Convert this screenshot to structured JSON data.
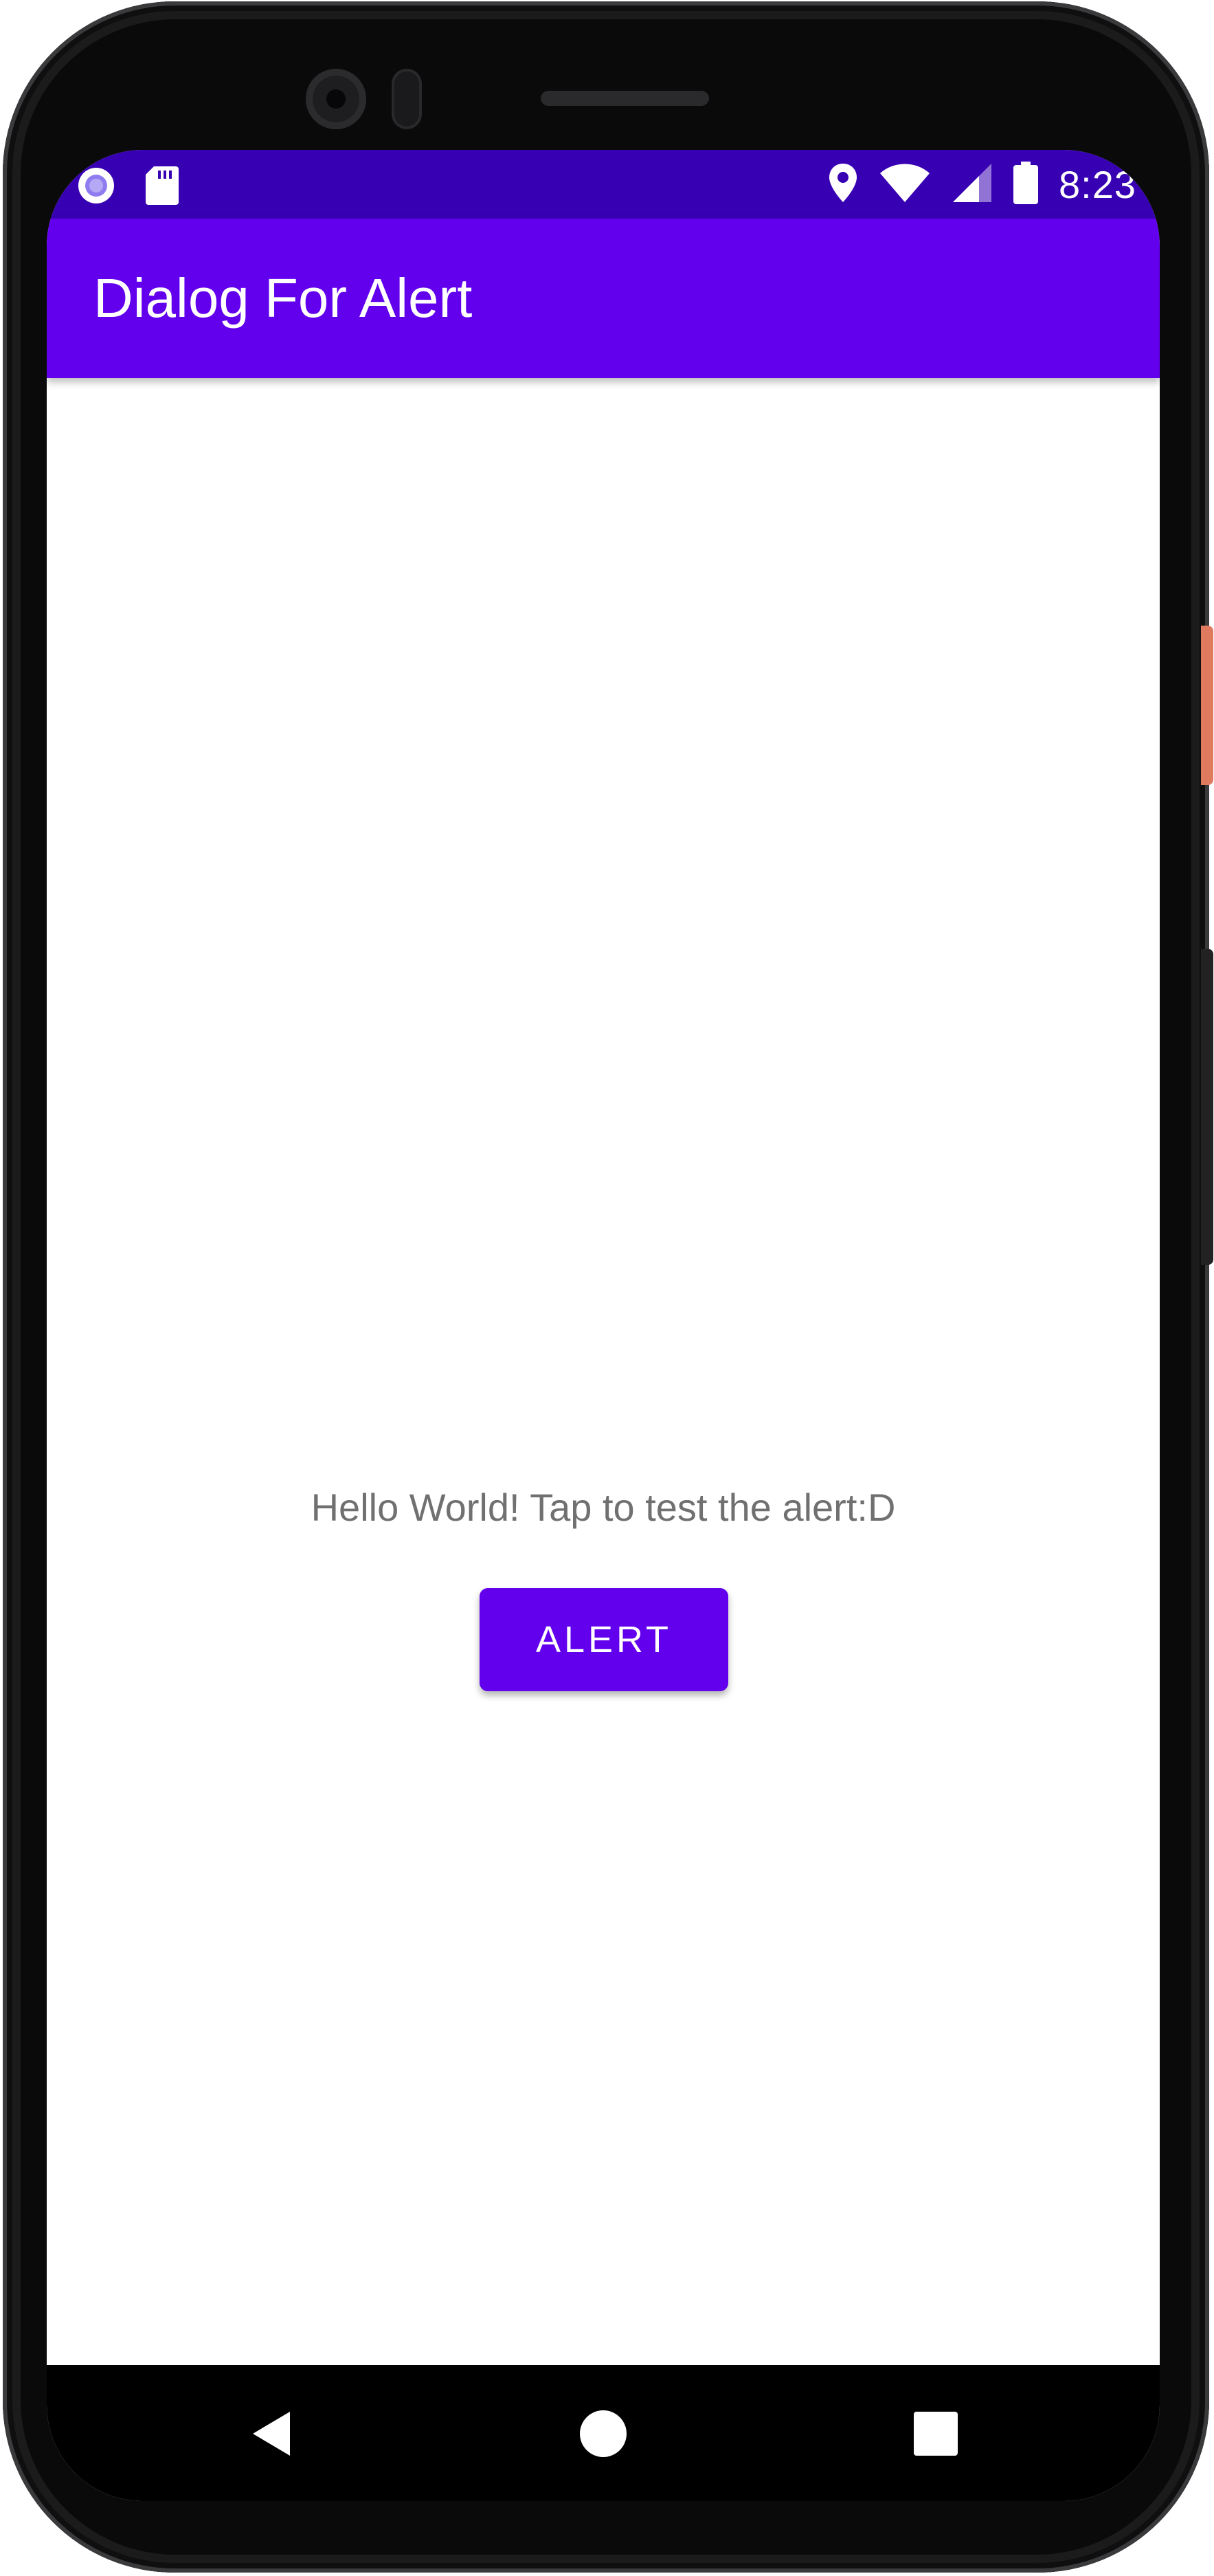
{
  "status_bar": {
    "time": "8:23",
    "left_icons": [
      "record-icon",
      "sd-card-icon"
    ],
    "right_icons": [
      "location-icon",
      "wifi-icon",
      "signal-icon",
      "battery-icon"
    ],
    "background_color": "#3700b3"
  },
  "app_bar": {
    "title": "Dialog For Alert",
    "background_color": "#6200ee"
  },
  "main": {
    "message": "Hello World! Tap to test the alert:D",
    "alert_button_label": "ALERT"
  },
  "nav_bar": {
    "buttons": [
      "back-icon",
      "home-icon",
      "recents-icon"
    ]
  },
  "colors": {
    "primary": "#6200ee",
    "primary_dark": "#3700b3",
    "text_secondary": "#707070"
  }
}
